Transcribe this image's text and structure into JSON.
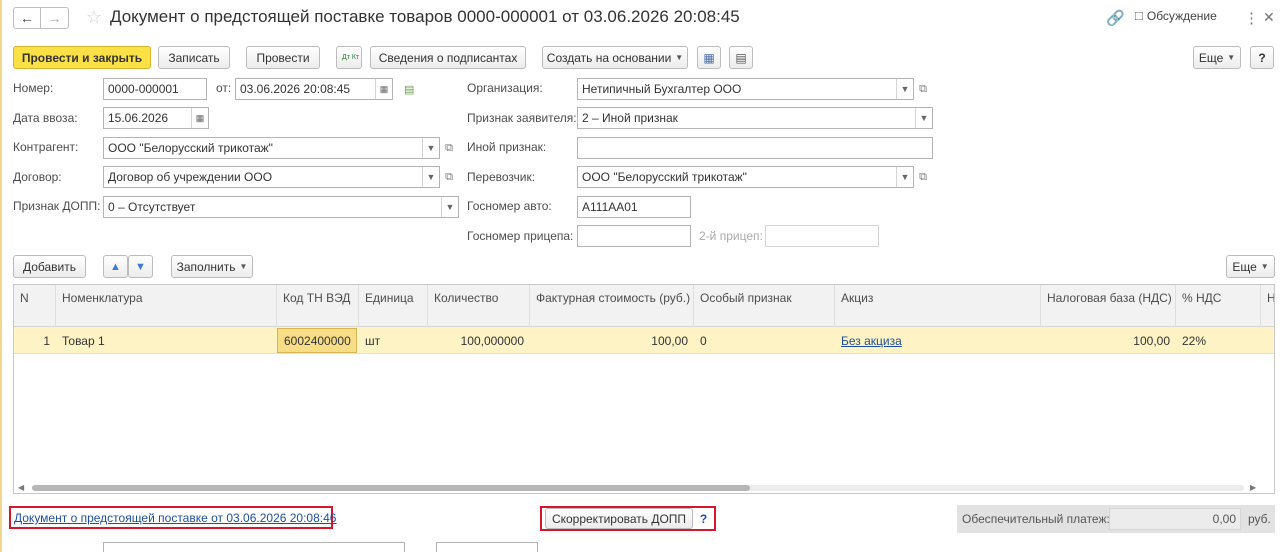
{
  "window": {
    "title": "Документ о предстоящей поставке товаров 0000-000001 от 03.06.2026 20:08:45",
    "discuss_label": "Обсуждение"
  },
  "toolbar": {
    "post_close": "Провести и закрыть",
    "save": "Записать",
    "post": "Провести",
    "dtkt_icon_text": "Дт Кт",
    "signers": "Сведения о подписантах",
    "create_based": "Создать на основании",
    "more": "Еще"
  },
  "form": {
    "number_label": "Номер:",
    "number_value": "0000-000001",
    "from_label": "от:",
    "from_value": "03.06.2026 20:08:45",
    "import_date_label": "Дата ввоза:",
    "import_date_value": "15.06.2026",
    "counterparty_label": "Контрагент:",
    "counterparty_value": "ООО \"Белорусский трикотаж\"",
    "contract_label": "Договор:",
    "contract_value": "Договор об учреждении ООО",
    "dopp_label": "Признак ДОПП:",
    "dopp_value": "0 – Отсутствует",
    "organization_label": "Организация:",
    "organization_value": "Нетипичный Бухгалтер ООО",
    "applicant_label": "Признак заявителя:",
    "applicant_value": "2 – Иной признак",
    "other_sign_label": "Иной признак:",
    "other_sign_value": "",
    "carrier_label": "Перевозчик:",
    "carrier_value": "ООО \"Белорусский трикотаж\"",
    "auto_label": "Госномер авто:",
    "auto_value": "А111АА01",
    "trailer_label": "Госномер прицепа:",
    "trailer_value": "",
    "trailer2_label": "2-й прицеп:",
    "trailer2_value": ""
  },
  "table_toolbar": {
    "add": "Добавить",
    "fill": "Заполнить",
    "more": "Еще"
  },
  "table": {
    "columns": [
      "N",
      "Номенклатура",
      "Код ТН ВЭД",
      "Единица",
      "Количество",
      "Фактурная стоимость (руб.)",
      "Особый признак",
      "Акциз",
      "Налоговая база (НДС)",
      "% НДС",
      "Н"
    ],
    "rows": [
      {
        "n": "1",
        "item": "Товар 1",
        "code": "6002400000",
        "unit": "шт",
        "qty": "100,000000",
        "cost": "100,00",
        "special": "0",
        "excise": "Без акциза",
        "tax_base": "100,00",
        "vat": "22%"
      }
    ]
  },
  "footer": {
    "doc_link": "Документ о предстоящей поставке от 03.06.2026 20:08:46",
    "correct_button": "Скорректировать ДОПП",
    "help": "?",
    "payment_label": "Обеспечительный платеж:",
    "payment_value": "0,00",
    "currency": "руб."
  },
  "colors": {
    "primary_button": "#fbe046",
    "selected_row": "#fdf3c4",
    "highlight_box": "#d7162b",
    "link": "#1d4f9c"
  }
}
